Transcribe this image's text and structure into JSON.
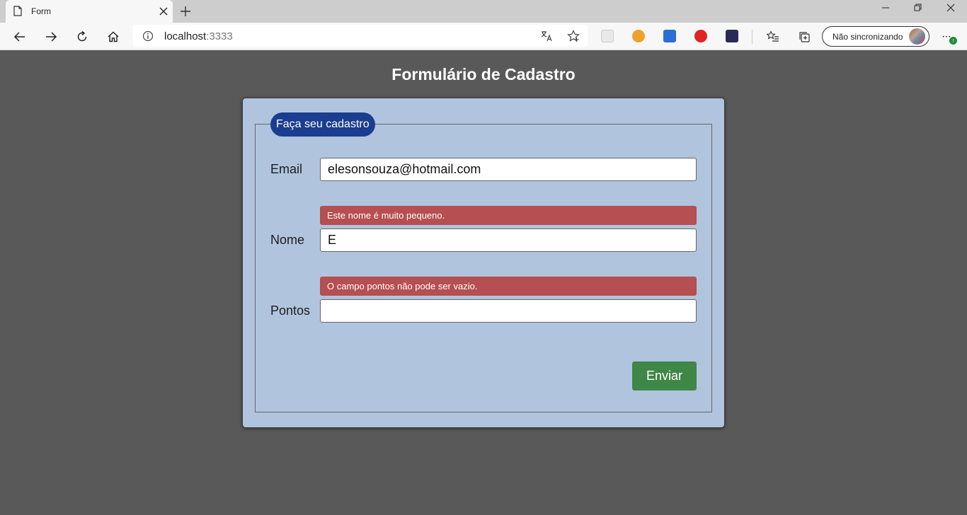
{
  "browser": {
    "tab_title": "Form",
    "url_host": "localhost",
    "url_port": ":3333",
    "profile_label": "Não sincronizando"
  },
  "page": {
    "title": "Formulário de Cadastro"
  },
  "form": {
    "legend": "Faça seu cadastro",
    "email": {
      "label": "Email",
      "value": "elesonsouza@hotmail.com"
    },
    "nome": {
      "label": "Nome",
      "value": "E",
      "error": "Este nome é muito pequeno."
    },
    "pontos": {
      "label": "Pontos",
      "value": "",
      "error": "O campo pontos não pode ser vazio."
    },
    "submit_label": "Enviar"
  },
  "colors": {
    "page_bg": "#595959",
    "card_bg": "#b0c4de",
    "legend_bg": "#1a3d8f",
    "error_bg": "#b54f51",
    "submit_bg": "#3f8746"
  }
}
